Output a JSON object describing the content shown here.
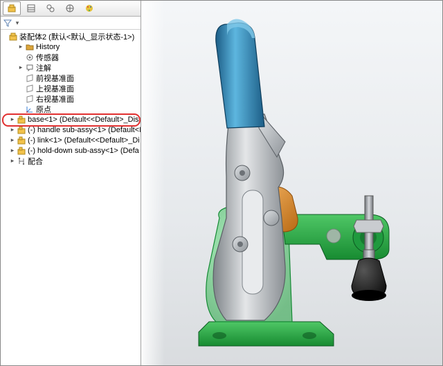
{
  "tabs": [
    "assembly",
    "feature-manager",
    "config",
    "display",
    "appearance"
  ],
  "root": {
    "icon": "assembly",
    "label": "装配体2 (默认<默认_显示状态-1>)"
  },
  "tree": [
    {
      "depth": 1,
      "exp": "▸",
      "icon": "folder",
      "label": "History"
    },
    {
      "depth": 1,
      "exp": "",
      "icon": "sensor",
      "label": "传感器"
    },
    {
      "depth": 1,
      "exp": "▸",
      "icon": "annot",
      "label": "注解"
    },
    {
      "depth": 1,
      "exp": "",
      "icon": "plane",
      "label": "前视基准面"
    },
    {
      "depth": 1,
      "exp": "",
      "icon": "plane",
      "label": "上视基准面"
    },
    {
      "depth": 1,
      "exp": "",
      "icon": "plane",
      "label": "右视基准面"
    },
    {
      "depth": 1,
      "exp": "",
      "icon": "origin",
      "label": "原点"
    },
    {
      "depth": 0,
      "exp": "▸",
      "icon": "part-fixed",
      "label": "base<1> (Default<<Default>_Disp"
    },
    {
      "depth": 0,
      "exp": "▸",
      "icon": "part",
      "label": "(-) handle sub-assy<1> (Default<I"
    },
    {
      "depth": 0,
      "exp": "▸",
      "icon": "part",
      "label": "(-) link<1> (Default<<Default>_Di"
    },
    {
      "depth": 0,
      "exp": "▸",
      "icon": "part",
      "label": "(-) hold-down sub-assy<1> (Defa"
    },
    {
      "depth": 0,
      "exp": "▸",
      "icon": "mates",
      "label": "配合"
    }
  ],
  "model_desc": "Toggle clamp assembly: green base plate, grey metal lever arm, orange link, blue handle grip, dark rubber tip on spindle; red star decal on base.",
  "colors": {
    "handle": "#2a7fb0",
    "handleHi": "#5db6df",
    "steel": "#b8bcc0",
    "steelHi": "#e4e6e8",
    "steelLo": "#7e8489",
    "link": "#de8a2a",
    "linkHi": "#f4b463",
    "base": "#2aa845",
    "baseHi": "#6fd97f",
    "baseGlass": "rgba(56,200,90,0.55)",
    "rubber": "#222",
    "spindle": "#9a9ea2",
    "star": "#e02828"
  }
}
